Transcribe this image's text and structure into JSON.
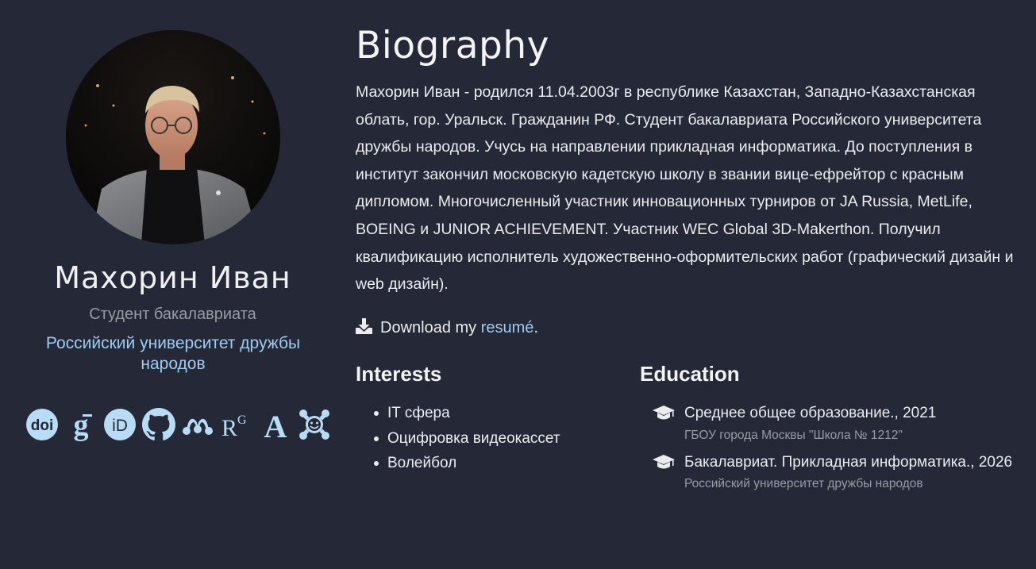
{
  "profile": {
    "name": "Махорин Иван",
    "role": "Студент бакалавриата",
    "organization": "Российский университет дружбы народов",
    "social": [
      {
        "icon": "doi-icon",
        "label": "doi"
      },
      {
        "icon": "google-scholar-icon",
        "label": "g"
      },
      {
        "icon": "orcid-icon",
        "label": "iD"
      },
      {
        "icon": "github-icon",
        "label": ""
      },
      {
        "icon": "mendeley-icon",
        "label": ""
      },
      {
        "icon": "researchgate-icon",
        "label": "RG"
      },
      {
        "icon": "academia-icon",
        "label": "A"
      },
      {
        "icon": "osf-icon",
        "label": ""
      }
    ]
  },
  "biography": {
    "title": "Biography",
    "text": "Махорин Иван - родился 11.04.2003г в республике Казахстан, Западно-Казахстанская облать, гор. Уральск. Гражданин РФ. Студент бакалавриата Российского университета дружбы народов. Учусь на направлении прикладная информатика. До поступления в институт закончил московскую кадетскую школу в звании вице-ефрейтор с красным дипломом. Многочисленный участник инновационных турниров от JA Russia, MetLife, BOEING и JUNIOR ACHIEVEMENT. Участник WEC Global 3D-Makerthon. Получил квалификацию исполнитель художественно-оформительских работ (графический дизайн и web дизайн).",
    "download_prefix": "Download my",
    "download_link": "resumé",
    "download_suffix": "."
  },
  "interests": {
    "title": "Interests",
    "items": [
      "IT сфера",
      "Оцифровка видеокассет",
      "Волейбол"
    ]
  },
  "education": {
    "title": "Education",
    "items": [
      {
        "course": "Среднее общее образование., 2021",
        "institution": "ГБОУ города Москвы \"Школа № 1212\""
      },
      {
        "course": "Бакалавриат. Прикладная информатика., 2026",
        "institution": "Российский университет дружбы народов"
      }
    ]
  },
  "colors": {
    "background": "#252836",
    "accent": "#9fcbf0",
    "icon": "#b9dcf6",
    "muted": "#9a9ba3"
  }
}
